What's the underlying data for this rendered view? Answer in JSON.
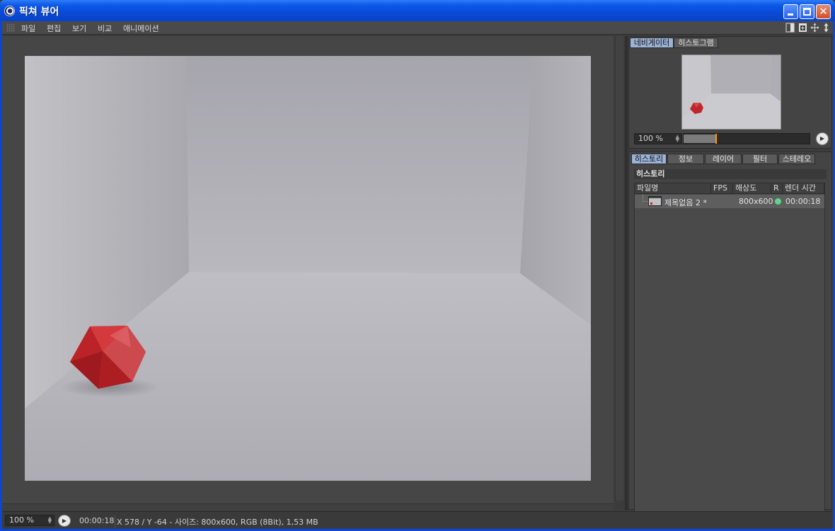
{
  "window": {
    "title": "픽쳐 뷰어",
    "app_icon": "cinema4d-icon",
    "controls": {
      "minimize": "minimize-icon",
      "maximize": "maximize-icon",
      "close": "close-icon"
    },
    "titlebar_color": "#0a4ad6"
  },
  "menu": {
    "items": [
      "파일",
      "편집",
      "보기",
      "비교",
      "애니메이션"
    ],
    "tool_icons": [
      "layout-icon",
      "new-panel-icon",
      "move-icon",
      "pin-icon"
    ]
  },
  "navigator": {
    "tabs": [
      "네비게이터",
      "히스토그램"
    ],
    "active_tab": "네비게이터",
    "zoom": "100 %",
    "zoom_level": 0.25
  },
  "history": {
    "tabs": [
      "히스토리",
      "정보",
      "레이어",
      "필터",
      "스테레오"
    ],
    "active_tab": "히스토리",
    "section_title": "히스토리",
    "columns": [
      "파일명",
      "FPS",
      "해상도",
      "R",
      "렌더 시간"
    ],
    "rows": [
      {
        "filename": "제목없음 2 *",
        "fps": "",
        "resolution": "800x600",
        "status": "green",
        "render_time": "00:00:18"
      }
    ]
  },
  "status": {
    "zoom": "100 %",
    "time": "00:00:18",
    "info": "X 578 / Y -64 - 사이즈: 800x600, RGB (8Bit), 1,53 MB"
  },
  "colors": {
    "accent_tab": "#9bb2d6",
    "render_ok": "#5ed68a",
    "slider_marker": "#ff9d00",
    "object": "#c8242a"
  }
}
